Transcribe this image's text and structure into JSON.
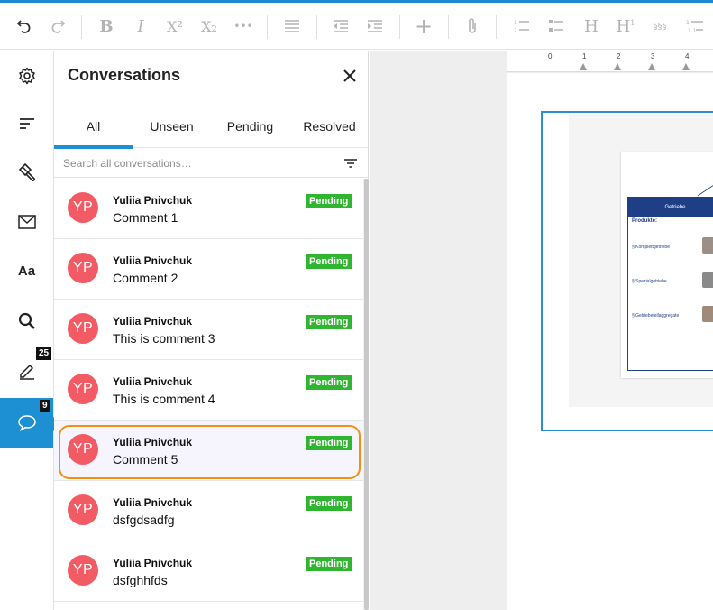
{
  "toolbar": {
    "items": [
      {
        "name": "undo-button",
        "icon": "undo-icon",
        "active": true
      },
      {
        "name": "redo-button",
        "icon": "redo-icon"
      },
      {
        "name": "bold-button",
        "glyph": "B"
      },
      {
        "name": "italic-button",
        "glyph": "I"
      },
      {
        "name": "superscript-button",
        "glyph": "X²"
      },
      {
        "name": "subscript-button",
        "glyph": "X₂"
      },
      {
        "name": "more-button",
        "glyph": "•••"
      },
      {
        "name": "align-button",
        "icon": "align-icon"
      },
      {
        "name": "outdent-button",
        "icon": "outdent-icon"
      },
      {
        "name": "indent-button",
        "icon": "indent-icon"
      },
      {
        "name": "insert-button",
        "glyph": "+"
      },
      {
        "name": "attach-button",
        "icon": "paperclip-icon"
      },
      {
        "name": "numbered-list-button",
        "icon": "numbered-list-icon"
      },
      {
        "name": "bullet-list-button",
        "icon": "bullet-list-icon"
      },
      {
        "name": "heading-button",
        "glyph": "H"
      },
      {
        "name": "heading-number-button",
        "glyph": "H"
      },
      {
        "name": "section-button",
        "glyph": "§§§"
      },
      {
        "name": "outline-button",
        "icon": "outline-icon"
      }
    ]
  },
  "rail": {
    "items": [
      {
        "name": "settings",
        "icon": "gear-icon"
      },
      {
        "name": "structure",
        "icon": "lines-icon"
      },
      {
        "name": "styles",
        "icon": "brush-icon"
      },
      {
        "name": "messages",
        "icon": "envelope-icon"
      },
      {
        "name": "typography",
        "icon": "text-icon",
        "label": "Aa"
      },
      {
        "name": "search",
        "icon": "magnifier-icon"
      },
      {
        "name": "edits",
        "icon": "pencil-icon",
        "badge": "25"
      },
      {
        "name": "conversations",
        "icon": "speech-bubble-icon",
        "badge": "9",
        "active": true
      }
    ]
  },
  "panel": {
    "title": "Conversations",
    "tabs": [
      {
        "label": "All",
        "active": true
      },
      {
        "label": "Unseen"
      },
      {
        "label": "Pending"
      },
      {
        "label": "Resolved"
      }
    ],
    "search": {
      "placeholder": "Search all conversations…"
    },
    "conversations": [
      {
        "initials": "YP",
        "author": "Yuliia Pnivchuk",
        "text": "Comment 1",
        "status": "Pending"
      },
      {
        "initials": "YP",
        "author": "Yuliia Pnivchuk",
        "text": "Comment 2",
        "status": "Pending"
      },
      {
        "initials": "YP",
        "author": "Yuliia Pnivchuk",
        "text": "This is comment 3",
        "status": "Pending"
      },
      {
        "initials": "YP",
        "author": "Yuliia Pnivchuk",
        "text": "This is comment 4",
        "status": "Pending"
      },
      {
        "initials": "YP",
        "author": "Yuliia Pnivchuk",
        "text": "Comment 5",
        "status": "Pending",
        "highlighted": true
      },
      {
        "initials": "YP",
        "author": "Yuliia Pnivchuk",
        "text": "dsfgdsadfg",
        "status": "Pending"
      },
      {
        "initials": "YP",
        "author": "Yuliia Pnivchuk",
        "text": "dsfghhfds",
        "status": "Pending"
      }
    ]
  },
  "ruler": {
    "labels": [
      "0",
      "1",
      "2",
      "3",
      "4"
    ]
  },
  "document": {
    "slide_title": "Getriebe",
    "slide_subtitle": "Produkte:",
    "slide_lines": [
      "§ Komplettgetriebe",
      "§ Spezialgetriebe",
      "§ Getriebeteilaggregate"
    ]
  },
  "colors": {
    "accent": "#1d8fd3",
    "avatar": "#f25b63",
    "pending": "#2fb52f",
    "focus": "#f0920f",
    "slide_blue": "#1e3f86"
  }
}
